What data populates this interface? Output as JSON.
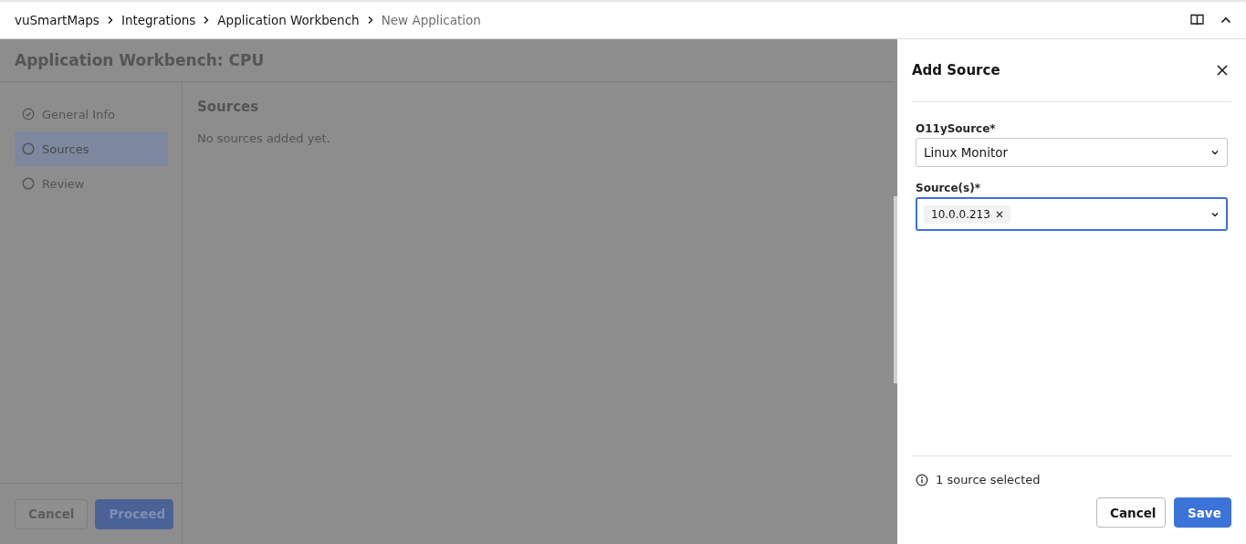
{
  "breadcrumb": [
    {
      "label": "vuSmartMaps",
      "current": false
    },
    {
      "label": "Integrations",
      "current": false
    },
    {
      "label": "Application Workbench",
      "current": false
    },
    {
      "label": "New Application",
      "current": true
    }
  ],
  "page": {
    "title": "Application Workbench: CPU",
    "steps": [
      {
        "label": "General Info",
        "completed": true,
        "selected": false
      },
      {
        "label": "Sources",
        "completed": false,
        "selected": true
      },
      {
        "label": "Review",
        "completed": false,
        "selected": false
      }
    ],
    "section_title": "Sources",
    "empty_message": "No sources added yet.",
    "buttons": [
      {
        "label": "Cancel",
        "kind": "secondary"
      },
      {
        "label": "Proceed",
        "kind": "primary"
      }
    ]
  },
  "drawer": {
    "title": "Add Source",
    "fields": [
      {
        "label": "O11ySource*",
        "kind": "select",
        "value": "Linux Monitor",
        "focused": false
      },
      {
        "label": "Source(s)*",
        "kind": "multiselect",
        "tags": [
          "10.0.0.213"
        ],
        "focused": true
      }
    ],
    "info": "1 source selected",
    "buttons": [
      {
        "label": "Cancel",
        "kind": "secondary"
      },
      {
        "label": "Save",
        "kind": "primary"
      }
    ]
  }
}
